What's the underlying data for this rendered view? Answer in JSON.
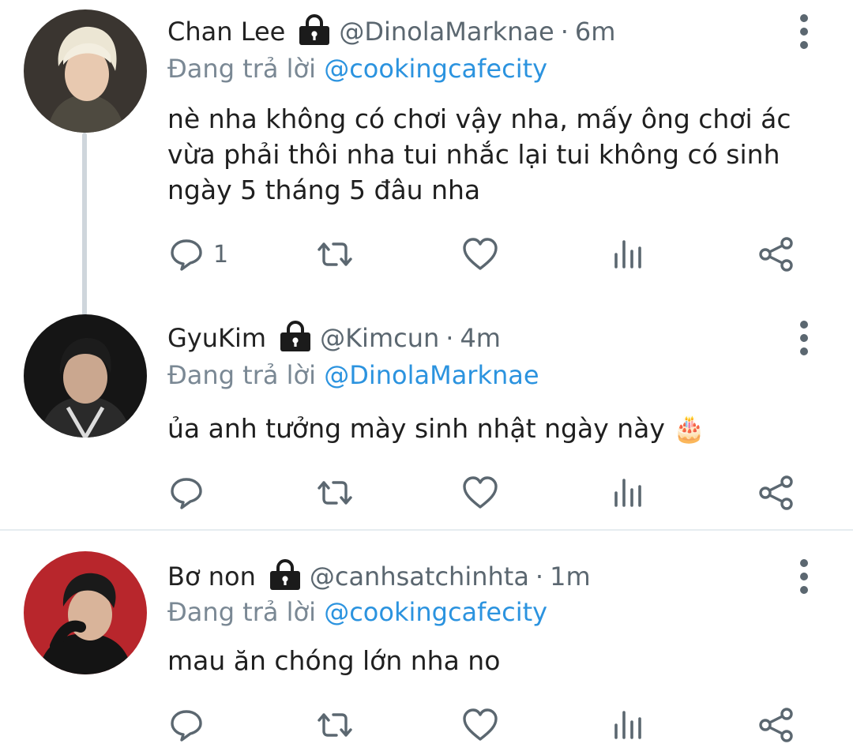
{
  "tweets": [
    {
      "name": "Chan Lee",
      "handle": "@DinolaMarknae",
      "separator": "·",
      "time": "6m",
      "reply_prefix": "Đang trả lời",
      "reply_to": "@cookingcafecity",
      "text": "nè nha không có chơi vậy nha, mấy ông chơi ác vừa phải thôi nha tui nhắc lại tui không có sinh ngày 5 tháng 5 đâu nha",
      "reply_count": "1"
    },
    {
      "name": "GyuKim",
      "handle": "@Kimcun",
      "separator": "·",
      "time": "4m",
      "reply_prefix": "Đang trả lời",
      "reply_to": "@DinolaMarknae",
      "text": "ủa anh tưởng mày sinh nhật ngày này 🎂",
      "reply_count": ""
    },
    {
      "name": "Bơ non",
      "handle": "@canhsatchinhta",
      "separator": "·",
      "time": "1m",
      "reply_prefix": "Đang trả lời",
      "reply_to": "@cookingcafecity",
      "text": "mau ăn chóng lớn nha no",
      "reply_count": ""
    }
  ],
  "icons": [
    "lock-icon",
    "reply-icon",
    "retweet-icon",
    "like-icon",
    "analytics-icon",
    "share-icon",
    "more-vertical-icon"
  ],
  "colors": {
    "accent": "#2b93df",
    "icon": "#5b6770",
    "thread_line": "#cfd6dc",
    "divider": "#e6ecf0"
  }
}
